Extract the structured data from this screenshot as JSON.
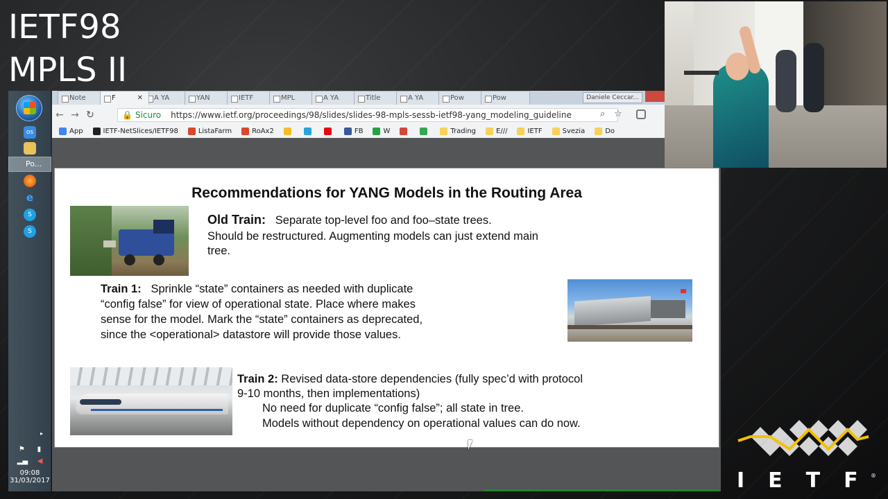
{
  "overlay": {
    "line1": "IETF98",
    "line2": "MPLS II"
  },
  "taskbar": {
    "active_item_label": "Po...",
    "time": "09:08",
    "date": "31/03/2017"
  },
  "browser": {
    "tabs": [
      {
        "label": "Note"
      },
      {
        "label": "F",
        "close": "✕"
      },
      {
        "label": "A YA"
      },
      {
        "label": "YAN"
      },
      {
        "label": "IETF"
      },
      {
        "label": "MPL"
      },
      {
        "label": "A YA"
      },
      {
        "label": "Title"
      },
      {
        "label": "A YA"
      },
      {
        "label": "Pow"
      },
      {
        "label": "Pow"
      }
    ],
    "profile": "Daniele Ceccar...",
    "secure_label": "Sicuro",
    "url": "https://www.ietf.org/proceedings/98/slides/slides-98-mpls-sessb-ietf98-yang_modeling_guideline",
    "bookmarks": [
      {
        "label": "App",
        "color": "#4285f4"
      },
      {
        "label": "IETF-NetSlices/IETF98",
        "color": "#222222"
      },
      {
        "label": "ListaFarm",
        "color": "#d9482b"
      },
      {
        "label": "RoAx2",
        "color": "#d9482b"
      },
      {
        "label": "",
        "color": "#f6c026"
      },
      {
        "label": "",
        "color": "#2aa3e0"
      },
      {
        "label": "",
        "color": "#e50914"
      },
      {
        "label": "FB",
        "color": "#3b5998"
      },
      {
        "label": "W",
        "color": "#25a244"
      },
      {
        "label": "",
        "color": "#d44638"
      },
      {
        "label": "",
        "color": "#34a853"
      },
      {
        "label": "Trading",
        "color": "#f6d25a"
      },
      {
        "label": "E///",
        "color": "#f6d25a"
      },
      {
        "label": "IETF",
        "color": "#f6d25a"
      },
      {
        "label": "Svezia",
        "color": "#f6d25a"
      },
      {
        "label": "Do",
        "color": "#f6d25a"
      }
    ]
  },
  "slide": {
    "title": "Recommendations for YANG Models in the Routing Area",
    "old_train": {
      "heading": "Old Train:",
      "line1": "Separate top-level foo and foo–state trees.",
      "line2": "Should be restructured.  Augmenting models can just extend main",
      "line3": "tree."
    },
    "train1": {
      "heading": "Train 1:",
      "line1": "Sprinkle “state” containers as needed with duplicate",
      "line2": "“config false” for view of operational state.   Place where makes",
      "line3": "sense for the model.  Mark the “state” containers as deprecated,",
      "line4": "since the <operational> datastore will provide those values."
    },
    "train2": {
      "heading": "Train 2:",
      "line1": "Revised data-store dependencies (fully spec’d with protocol",
      "line2": "9-10 months, then implementations)",
      "line3": "No need for duplicate “config false”; all state in tree.",
      "line4": "Models without dependency on operational values can do now."
    }
  },
  "logo": {
    "letters": "IETF",
    "reg": "®"
  },
  "colors": {
    "logo_yellow": "#f2c200",
    "logo_diamond": "#d6d6d6",
    "slide_bg": "#ffffff"
  }
}
